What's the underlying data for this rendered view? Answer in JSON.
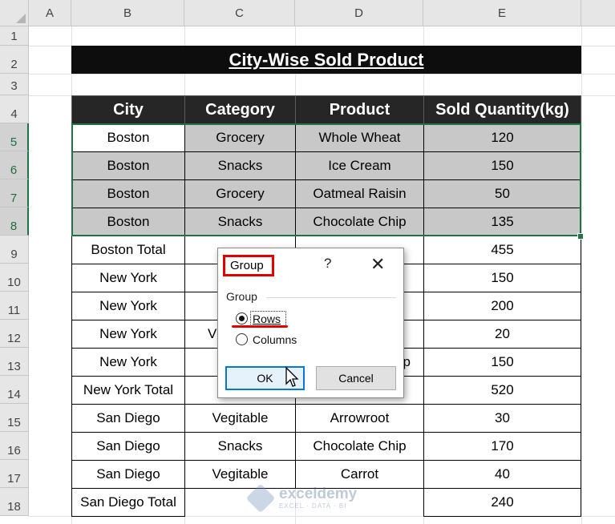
{
  "columns": [
    "A",
    "B",
    "C",
    "D",
    "E"
  ],
  "rows": [
    "1",
    "2",
    "3",
    "4",
    "5",
    "6",
    "7",
    "8",
    "9",
    "10",
    "11",
    "12",
    "13",
    "14",
    "15",
    "16",
    "17",
    "18"
  ],
  "title": "City-Wise Sold Product",
  "table": {
    "headers": [
      "City",
      "Category",
      "Product",
      "Sold Quantity(kg)"
    ],
    "rows": [
      [
        "Boston",
        "Grocery",
        "Whole Wheat",
        "120"
      ],
      [
        "Boston",
        "Snacks",
        "Ice Cream",
        "150"
      ],
      [
        "Boston",
        "Grocery",
        "Oatmeal Raisin",
        "50"
      ],
      [
        "Boston",
        "Snacks",
        "Chocolate Chip",
        "135"
      ],
      [
        "Boston Total",
        "",
        "",
        "455"
      ],
      [
        "New York",
        "",
        "",
        "150"
      ],
      [
        "New York",
        "",
        "",
        "200"
      ],
      [
        "New York",
        "V",
        "",
        "20"
      ],
      [
        "New York",
        "",
        "p",
        "150"
      ],
      [
        "New York Total",
        "",
        "",
        "520"
      ],
      [
        "San Diego",
        "Vegitable",
        "Arrowroot",
        "30"
      ],
      [
        "San Diego",
        "Snacks",
        "Chocolate Chip",
        "170"
      ],
      [
        "San Diego",
        "Vegitable",
        "Carrot",
        "40"
      ],
      [
        "San Diego Total",
        "",
        "",
        "240"
      ]
    ]
  },
  "dialog": {
    "title": "Group",
    "help": "?",
    "close": "✕",
    "group_label": "Group",
    "options": [
      {
        "label": "Rows",
        "selected": true
      },
      {
        "label": "Columns",
        "selected": false
      }
    ],
    "ok_label": "OK",
    "cancel_label": "Cancel"
  },
  "watermark": {
    "name": "exceldemy",
    "tagline": "EXCEL · DATA · BI"
  },
  "colors": {
    "selection": "#217346",
    "highlight": "#e00000",
    "header_bg": "#262626",
    "shaded": "#c8c8c8"
  }
}
